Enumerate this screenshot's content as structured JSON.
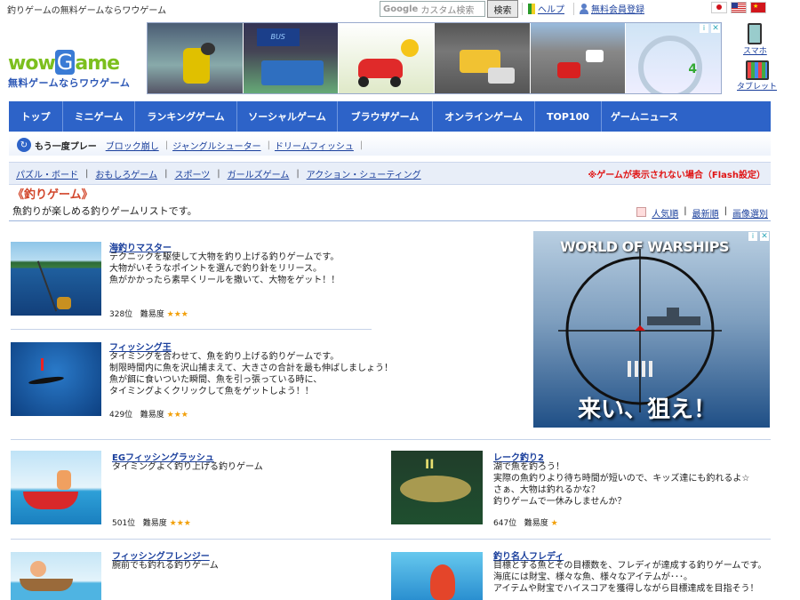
{
  "header": {
    "tagline": "釣りゲームの無料ゲームならワウゲーム",
    "search_brand": "Google",
    "search_placeholder": "カスタム検索",
    "search_button": "検索",
    "help": "ヘルプ",
    "signup": "無料会員登録"
  },
  "logo": {
    "wow": "wow",
    "g": "G",
    "ame": "ame",
    "sub": "無料ゲームならワウゲーム"
  },
  "devices": {
    "smartphone": "スマホ",
    "tablet": "タブレット"
  },
  "nav": [
    "トップ",
    "ミニゲーム",
    "ランキングゲーム",
    "ソーシャルゲーム",
    "ブラウザゲーム",
    "オンラインゲーム",
    "TOP100",
    "ゲームニュース"
  ],
  "replay": {
    "label": "もう一度プレー",
    "items": [
      "ブロック崩し",
      "ジャングルシューター",
      "ドリームフィッシュ"
    ]
  },
  "categories": [
    "パズル・ボード",
    "おもしろゲーム",
    "スポーツ",
    "ガールズゲーム",
    "アクション・シューティング"
  ],
  "flash_note": "※ゲームが表示されない場合（Flash設定）",
  "page": {
    "title": "《釣りゲーム》",
    "description": "魚釣りが楽しめる釣りゲームリストです。",
    "sort": [
      "人気順",
      "最新順",
      "画像選別"
    ]
  },
  "games": [
    {
      "title": "海釣りマスター",
      "desc": "テクニックを駆使して大物を釣り上げる釣りゲームです。\n大物がいそうなポイントを選んで釣り針をリリース。\n魚がかかったら素早くリールを撒いて、大物をゲット！！",
      "rank": "328位",
      "difficulty_label": "難易度",
      "stars": "★★★"
    },
    {
      "title": "フィッシング王",
      "desc": "タイミングを合わせて、魚を釣り上げる釣りゲームです。\n制限時間内に魚を沢山捕まえて、大きさの合計を最も伸ばしましょう！\n魚が餌に食いついた瞬間、魚を引っ張っている時に、\nタイミングよくクリックして魚をゲットしよう！！",
      "rank": "429位",
      "difficulty_label": "難易度",
      "stars": "★★★"
    },
    {
      "title": "EGフィッシングラッシュ",
      "desc": "タイミングよく釣り上げる釣りゲーム",
      "rank": "501位",
      "difficulty_label": "難易度",
      "stars": "★★★"
    },
    {
      "title": "レーク釣り2",
      "desc": "湖で魚を釣ろう！\n実際の魚釣りより待ち時間が短いので、キッズ達にも釣れるよ☆\nさぁ、大物は釣れるかな？\n釣りゲームで一休みしませんか？",
      "rank": "647位",
      "difficulty_label": "難易度",
      "stars": "★"
    },
    {
      "title": "フィッシングフレンジー",
      "desc": "腕前でも釣れる釣りゲーム"
    },
    {
      "title": "釣り名人フレディ",
      "desc": "目標とする魚とその目標数を、フレディが達成する釣りゲームです。\n海底には財宝、様々な魚、様々なアイテムが･･･。\nアイテムや財宝でハイスコアを獲得しながら目標達成を目指そう！"
    }
  ],
  "ad": {
    "brand": "WORLD OF WARSHIPS",
    "slogan": "来い、狙え！"
  },
  "colors": {
    "nav_blue": "#2d63c8",
    "title_red": "#d2462b",
    "star_orange": "#f2a00b",
    "link_blue": "#1a3f9c"
  }
}
